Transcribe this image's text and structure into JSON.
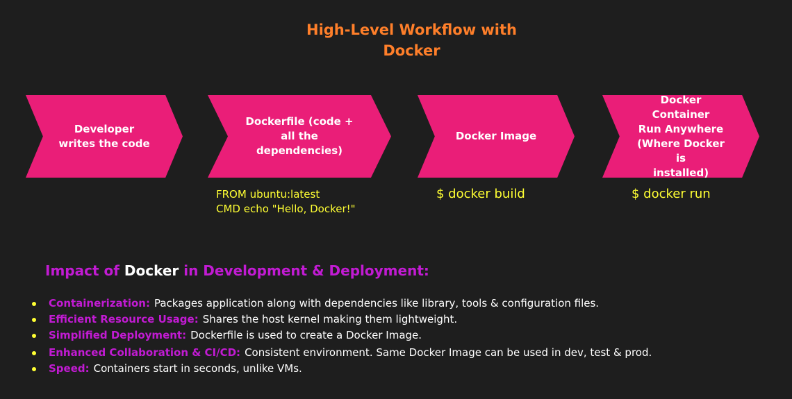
{
  "title": {
    "line1": "High-Level Workflow with",
    "line2": "Docker"
  },
  "workflow": [
    {
      "lines": [
        "Developer",
        "writes the code"
      ]
    },
    {
      "lines": [
        "Dockerfile (code +",
        "all the dependencies)"
      ]
    },
    {
      "lines": [
        "Docker Image"
      ]
    },
    {
      "lines": [
        "Docker Container",
        "Run Anywhere",
        "(Where Docker is",
        "installed)"
      ]
    }
  ],
  "annotations": {
    "dockerfile_code": [
      "FROM ubuntu:latest",
      "CMD echo \"Hello, Docker!\""
    ],
    "build_cmd": "$ docker build",
    "run_cmd": "$ docker run"
  },
  "impact": {
    "heading_prefix": "Impact of",
    "heading_highlight": "Docker",
    "heading_suffix": "in Development & Deployment:",
    "items": [
      {
        "term": "Containerization:",
        "text": "Packages application along with dependencies like library, tools & configuration files."
      },
      {
        "term": "Efficient Resource Usage:",
        "text": "Shares the host kernel making them lightweight."
      },
      {
        "term": "Simplified Deployment:",
        "text": "Dockerfile is used to create a Docker Image."
      },
      {
        "term": "Enhanced Collaboration & CI/CD:",
        "text": "Consistent environment. Same Docker Image can be used in dev, test & prod."
      },
      {
        "term": "Speed:",
        "text": "Containers start in seconds, unlike VMs."
      }
    ]
  },
  "colors": {
    "background": "#1e1e1e",
    "title": "#ff7f2a",
    "chevron": "#ea1e78",
    "annotation": "#ffff33",
    "term": "#c21bd3"
  }
}
